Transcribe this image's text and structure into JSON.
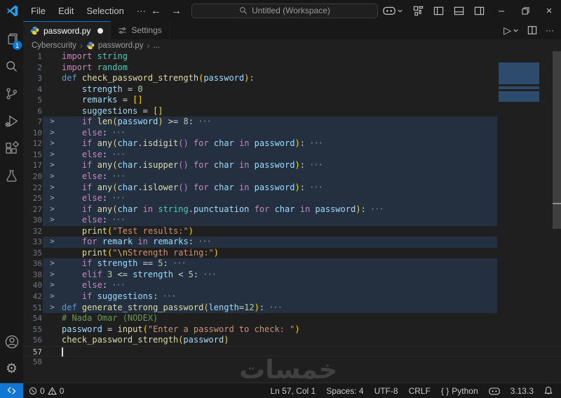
{
  "titlebar": {
    "menus": [
      "File",
      "Edit",
      "Selection",
      "···"
    ],
    "nav_back": "←",
    "nav_forward": "→",
    "command_center": "Untitled (Workspace)",
    "minimize_glyph": "–",
    "close_glyph": "×"
  },
  "activitybar": {
    "explorer_badge": "1",
    "gear_glyph": "⚙"
  },
  "tabs": [
    {
      "label": "password.py",
      "modified": true
    },
    {
      "label": "Settings",
      "modified": false
    }
  ],
  "editor_actions": {
    "run_glyph": "▷",
    "more_glyph": "···"
  },
  "breadcrumb": {
    "items": [
      "Cyberscurity",
      "password.py",
      "..."
    ],
    "separator": "›"
  },
  "watermark": "خمسات",
  "statusbar": {
    "errors": "0",
    "warnings": "0",
    "ln_col": "Ln 57, Col 1",
    "spaces": "Spaces: 4",
    "encoding": "UTF-8",
    "eol": "CRLF",
    "lang_braces": "{ }",
    "language": "Python",
    "py_version": "3.13.3"
  },
  "ui_colors": {
    "accent": "#0078d4",
    "editor_bg": "#1f1f1f",
    "chrome_bg": "#181818",
    "fold_highlight": "#24303f",
    "remote_bg": "#1277d3"
  },
  "palette": {
    "kw": "#C586C0",
    "def": "#569CD6",
    "fn": "#DCDCAA",
    "v": "#9CDCFE",
    "cls": "#4EC9B0",
    "str": "#CE9178",
    "esc": "#D7BA7D",
    "num": "#B5CEA8",
    "d": "#D4D4D4",
    "p1": "#FFD700",
    "p2": "#DA70D6",
    "fold": "#8a8a8a",
    "cmt": "#6A9955"
  },
  "editor": {
    "cursor": {
      "line": 57,
      "col": 1
    },
    "lines": [
      {
        "n": 1,
        "t": [
          [
            "kw",
            "import"
          ],
          [
            "d",
            " "
          ],
          [
            "cls",
            "string"
          ]
        ]
      },
      {
        "n": 2,
        "t": [
          [
            "kw",
            "import"
          ],
          [
            "d",
            " "
          ],
          [
            "cls",
            "random"
          ]
        ]
      },
      {
        "n": 3,
        "t": [
          [
            "def",
            "def"
          ],
          [
            "d",
            " "
          ],
          [
            "fn",
            "check_password_strength"
          ],
          [
            "p1",
            "("
          ],
          [
            "v",
            "password"
          ],
          [
            "p1",
            ")"
          ],
          [
            "d",
            ":"
          ]
        ]
      },
      {
        "n": 4,
        "t": [
          [
            "d",
            "    "
          ],
          [
            "v",
            "strength"
          ],
          [
            "d",
            " = "
          ],
          [
            "num",
            "0"
          ]
        ]
      },
      {
        "n": 5,
        "t": [
          [
            "d",
            "    "
          ],
          [
            "v",
            "remarks"
          ],
          [
            "d",
            " = "
          ],
          [
            "p1",
            "[]"
          ]
        ]
      },
      {
        "n": 6,
        "t": [
          [
            "d",
            "    "
          ],
          [
            "v",
            "suggestions"
          ],
          [
            "d",
            " = "
          ],
          [
            "p1",
            "[]"
          ]
        ]
      },
      {
        "n": 7,
        "f": true,
        "h": true,
        "t": [
          [
            "d",
            "    "
          ],
          [
            "kw",
            "if"
          ],
          [
            "d",
            " "
          ],
          [
            "fn",
            "len"
          ],
          [
            "p1",
            "("
          ],
          [
            "v",
            "password"
          ],
          [
            "p1",
            ")"
          ],
          [
            "d",
            " >= "
          ],
          [
            "num",
            "8"
          ],
          [
            "d",
            ":"
          ],
          [
            "fold",
            " ···"
          ]
        ]
      },
      {
        "n": 10,
        "f": true,
        "h": true,
        "t": [
          [
            "d",
            "    "
          ],
          [
            "kw",
            "else"
          ],
          [
            "d",
            ":"
          ],
          [
            "fold",
            " ···"
          ]
        ]
      },
      {
        "n": 12,
        "f": true,
        "h": true,
        "t": [
          [
            "d",
            "    "
          ],
          [
            "kw",
            "if"
          ],
          [
            "d",
            " "
          ],
          [
            "fn",
            "any"
          ],
          [
            "p1",
            "("
          ],
          [
            "v",
            "char"
          ],
          [
            "d",
            "."
          ],
          [
            "fn",
            "isdigit"
          ],
          [
            "p2",
            "()"
          ],
          [
            "d",
            " "
          ],
          [
            "kw",
            "for"
          ],
          [
            "d",
            " "
          ],
          [
            "v",
            "char"
          ],
          [
            "d",
            " "
          ],
          [
            "kw",
            "in"
          ],
          [
            "d",
            " "
          ],
          [
            "v",
            "password"
          ],
          [
            "p1",
            ")"
          ],
          [
            "d",
            ":"
          ],
          [
            "fold",
            " ···"
          ]
        ]
      },
      {
        "n": 15,
        "f": true,
        "h": true,
        "t": [
          [
            "d",
            "    "
          ],
          [
            "kw",
            "else"
          ],
          [
            "d",
            ":"
          ],
          [
            "fold",
            " ···"
          ]
        ]
      },
      {
        "n": 17,
        "f": true,
        "h": true,
        "t": [
          [
            "d",
            "    "
          ],
          [
            "kw",
            "if"
          ],
          [
            "d",
            " "
          ],
          [
            "fn",
            "any"
          ],
          [
            "p1",
            "("
          ],
          [
            "v",
            "char"
          ],
          [
            "d",
            "."
          ],
          [
            "fn",
            "isupper"
          ],
          [
            "p2",
            "()"
          ],
          [
            "d",
            " "
          ],
          [
            "kw",
            "for"
          ],
          [
            "d",
            " "
          ],
          [
            "v",
            "char"
          ],
          [
            "d",
            " "
          ],
          [
            "kw",
            "in"
          ],
          [
            "d",
            " "
          ],
          [
            "v",
            "password"
          ],
          [
            "p1",
            ")"
          ],
          [
            "d",
            ":"
          ],
          [
            "fold",
            " ···"
          ]
        ]
      },
      {
        "n": 20,
        "f": true,
        "h": true,
        "t": [
          [
            "d",
            "    "
          ],
          [
            "kw",
            "else"
          ],
          [
            "d",
            ":"
          ],
          [
            "fold",
            " ···"
          ]
        ]
      },
      {
        "n": 22,
        "f": true,
        "h": true,
        "t": [
          [
            "d",
            "    "
          ],
          [
            "kw",
            "if"
          ],
          [
            "d",
            " "
          ],
          [
            "fn",
            "any"
          ],
          [
            "p1",
            "("
          ],
          [
            "v",
            "char"
          ],
          [
            "d",
            "."
          ],
          [
            "fn",
            "islower"
          ],
          [
            "p2",
            "()"
          ],
          [
            "d",
            " "
          ],
          [
            "kw",
            "for"
          ],
          [
            "d",
            " "
          ],
          [
            "v",
            "char"
          ],
          [
            "d",
            " "
          ],
          [
            "kw",
            "in"
          ],
          [
            "d",
            " "
          ],
          [
            "v",
            "password"
          ],
          [
            "p1",
            ")"
          ],
          [
            "d",
            ":"
          ],
          [
            "fold",
            " ···"
          ]
        ]
      },
      {
        "n": 25,
        "f": true,
        "h": true,
        "t": [
          [
            "d",
            "    "
          ],
          [
            "kw",
            "else"
          ],
          [
            "d",
            ":"
          ],
          [
            "fold",
            " ···"
          ]
        ]
      },
      {
        "n": 27,
        "f": true,
        "h": true,
        "t": [
          [
            "d",
            "    "
          ],
          [
            "kw",
            "if"
          ],
          [
            "d",
            " "
          ],
          [
            "fn",
            "any"
          ],
          [
            "p1",
            "("
          ],
          [
            "v",
            "char"
          ],
          [
            "d",
            " "
          ],
          [
            "kw",
            "in"
          ],
          [
            "d",
            " "
          ],
          [
            "cls",
            "string"
          ],
          [
            "d",
            "."
          ],
          [
            "v",
            "punctuation"
          ],
          [
            "d",
            " "
          ],
          [
            "kw",
            "for"
          ],
          [
            "d",
            " "
          ],
          [
            "v",
            "char"
          ],
          [
            "d",
            " "
          ],
          [
            "kw",
            "in"
          ],
          [
            "d",
            " "
          ],
          [
            "v",
            "password"
          ],
          [
            "p1",
            ")"
          ],
          [
            "d",
            ":"
          ],
          [
            "fold",
            " ···"
          ]
        ]
      },
      {
        "n": 30,
        "f": true,
        "h": true,
        "t": [
          [
            "d",
            "    "
          ],
          [
            "kw",
            "else"
          ],
          [
            "d",
            ":"
          ],
          [
            "fold",
            " ···"
          ]
        ]
      },
      {
        "n": 32,
        "t": [
          [
            "d",
            "    "
          ],
          [
            "fn",
            "print"
          ],
          [
            "p1",
            "("
          ],
          [
            "str",
            "\"Test results:\""
          ],
          [
            "p1",
            ")"
          ]
        ]
      },
      {
        "n": 33,
        "f": true,
        "h": true,
        "t": [
          [
            "d",
            "    "
          ],
          [
            "kw",
            "for"
          ],
          [
            "d",
            " "
          ],
          [
            "v",
            "remark"
          ],
          [
            "d",
            " "
          ],
          [
            "kw",
            "in"
          ],
          [
            "d",
            " "
          ],
          [
            "v",
            "remarks"
          ],
          [
            "d",
            ":"
          ],
          [
            "fold",
            " ···"
          ]
        ]
      },
      {
        "n": 35,
        "t": [
          [
            "d",
            "    "
          ],
          [
            "fn",
            "print"
          ],
          [
            "p1",
            "("
          ],
          [
            "str",
            "\""
          ],
          [
            "esc",
            "\\n"
          ],
          [
            "str",
            "Strength rating:\""
          ],
          [
            "p1",
            ")"
          ]
        ]
      },
      {
        "n": 36,
        "f": true,
        "h": true,
        "t": [
          [
            "d",
            "    "
          ],
          [
            "kw",
            "if"
          ],
          [
            "d",
            " "
          ],
          [
            "v",
            "strength"
          ],
          [
            "d",
            " == "
          ],
          [
            "num",
            "5"
          ],
          [
            "d",
            ":"
          ],
          [
            "fold",
            " ···"
          ]
        ]
      },
      {
        "n": 38,
        "f": true,
        "h": true,
        "t": [
          [
            "d",
            "    "
          ],
          [
            "kw",
            "elif"
          ],
          [
            "d",
            " "
          ],
          [
            "num",
            "3"
          ],
          [
            "d",
            " <= "
          ],
          [
            "v",
            "strength"
          ],
          [
            "d",
            " < "
          ],
          [
            "num",
            "5"
          ],
          [
            "d",
            ":"
          ],
          [
            "fold",
            " ···"
          ]
        ]
      },
      {
        "n": 40,
        "f": true,
        "h": true,
        "t": [
          [
            "d",
            "    "
          ],
          [
            "kw",
            "else"
          ],
          [
            "d",
            ":"
          ],
          [
            "fold",
            " ···"
          ]
        ]
      },
      {
        "n": 42,
        "f": true,
        "h": true,
        "t": [
          [
            "d",
            "    "
          ],
          [
            "kw",
            "if"
          ],
          [
            "d",
            " "
          ],
          [
            "v",
            "suggestions"
          ],
          [
            "d",
            ":"
          ],
          [
            "fold",
            " ···"
          ]
        ]
      },
      {
        "n": 51,
        "f": true,
        "h": true,
        "t": [
          [
            "def",
            "def"
          ],
          [
            "d",
            " "
          ],
          [
            "fn",
            "generate_strong_password"
          ],
          [
            "p1",
            "("
          ],
          [
            "v",
            "length"
          ],
          [
            "d",
            "="
          ],
          [
            "num",
            "12"
          ],
          [
            "p1",
            ")"
          ],
          [
            "d",
            ":"
          ],
          [
            "fold",
            " ···"
          ]
        ]
      },
      {
        "n": 54,
        "t": [
          [
            "cmt",
            "# Nada Omar (NODEX)"
          ]
        ]
      },
      {
        "n": 55,
        "t": [
          [
            "v",
            "password"
          ],
          [
            "d",
            " = "
          ],
          [
            "fn",
            "input"
          ],
          [
            "p1",
            "("
          ],
          [
            "str",
            "\"Enter a password to check: \""
          ],
          [
            "p1",
            ")"
          ]
        ]
      },
      {
        "n": 56,
        "t": [
          [
            "fn",
            "check_password_strength"
          ],
          [
            "p1",
            "("
          ],
          [
            "v",
            "password"
          ],
          [
            "p1",
            ")"
          ]
        ]
      },
      {
        "n": 57,
        "cur": true,
        "t": []
      },
      {
        "n": 58,
        "t": []
      }
    ]
  }
}
